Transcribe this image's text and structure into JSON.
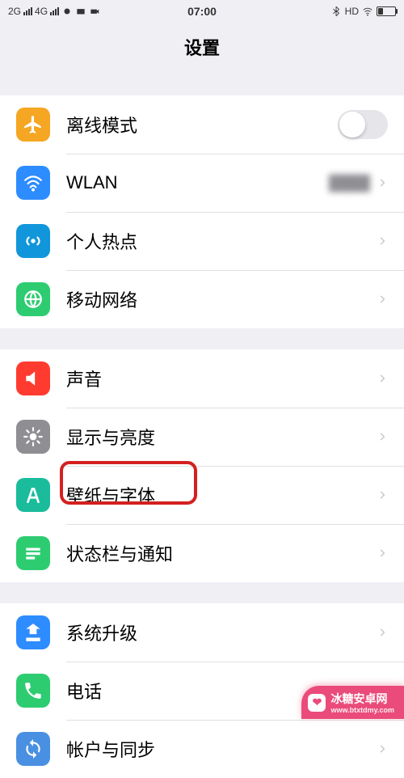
{
  "status": {
    "net1": "2G",
    "net2": "4G",
    "time": "07:00",
    "hd": "HD"
  },
  "header": {
    "title": "设置"
  },
  "sections": [
    {
      "rows": [
        {
          "label": "离线模式",
          "icon": "airplane",
          "color": "#f5a623",
          "control": "toggle"
        },
        {
          "label": "WLAN",
          "icon": "wifi",
          "color": "#2d8cff",
          "value": "████",
          "control": "chevron"
        },
        {
          "label": "个人热点",
          "icon": "hotspot",
          "color": "#1296db",
          "control": "chevron"
        },
        {
          "label": "移动网络",
          "icon": "globe",
          "color": "#2ecc71",
          "control": "chevron"
        }
      ]
    },
    {
      "rows": [
        {
          "label": "声音",
          "icon": "speaker",
          "color": "#ff3b30",
          "control": "chevron"
        },
        {
          "label": "显示与亮度",
          "icon": "brightness",
          "color": "#8e8e93",
          "control": "chevron"
        },
        {
          "label": "壁纸与字体",
          "icon": "font",
          "color": "#1abc9c",
          "control": "chevron",
          "highlight": true
        },
        {
          "label": "状态栏与通知",
          "icon": "statusbar",
          "color": "#2ecc71",
          "control": "chevron"
        }
      ]
    },
    {
      "rows": [
        {
          "label": "系统升级",
          "icon": "update",
          "color": "#2d8cff",
          "control": "chevron"
        },
        {
          "label": "电话",
          "icon": "phone",
          "color": "#2ecc71",
          "control": "chevron"
        },
        {
          "label": "帐户与同步",
          "icon": "sync",
          "color": "#4a90e2",
          "control": "chevron"
        }
      ]
    }
  ],
  "watermark": {
    "main": "冰糖安卓网",
    "sub": "www.btxtdmy.com"
  }
}
